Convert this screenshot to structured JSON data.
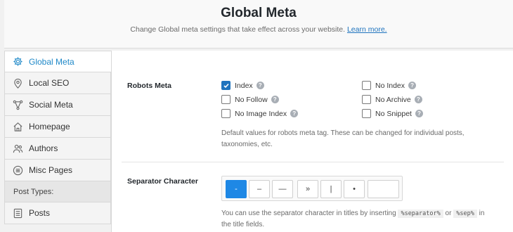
{
  "header": {
    "title": "Global Meta",
    "subtitle": "Change Global meta settings that take effect across your website.",
    "learn_more": "Learn more."
  },
  "sidebar": {
    "items": [
      {
        "label": "Global Meta",
        "icon": "gear-icon",
        "active": true
      },
      {
        "label": "Local SEO",
        "icon": "location-pin-icon"
      },
      {
        "label": "Social Meta",
        "icon": "share-icon"
      },
      {
        "label": "Homepage",
        "icon": "home-icon"
      },
      {
        "label": "Authors",
        "icon": "users-icon"
      },
      {
        "label": "Misc Pages",
        "icon": "list-circle-icon"
      }
    ],
    "section_label": "Post Types:",
    "post_types": [
      {
        "label": "Posts",
        "icon": "document-icon"
      }
    ]
  },
  "robots": {
    "label": "Robots Meta",
    "options": [
      {
        "label": "Index",
        "checked": true
      },
      {
        "label": "No Index",
        "checked": false
      },
      {
        "label": "No Follow",
        "checked": false
      },
      {
        "label": "No Archive",
        "checked": false
      },
      {
        "label": "No Image Index",
        "checked": false
      },
      {
        "label": "No Snippet",
        "checked": false
      }
    ],
    "description": "Default values for robots meta tag. These can be changed for individual posts, taxonomies, etc."
  },
  "separator": {
    "label": "Separator Character",
    "options": [
      "-",
      "–",
      "—",
      "»",
      "|",
      "•"
    ],
    "selected": "-",
    "description_prefix": "You can use the separator character in titles by inserting",
    "code1": "%separator%",
    "or": "or",
    "code2": "%sep%",
    "description_suffix": "in",
    "description_line2": "the title fields."
  },
  "colors": {
    "accent": "#1e88e5",
    "link": "#1e73be"
  }
}
